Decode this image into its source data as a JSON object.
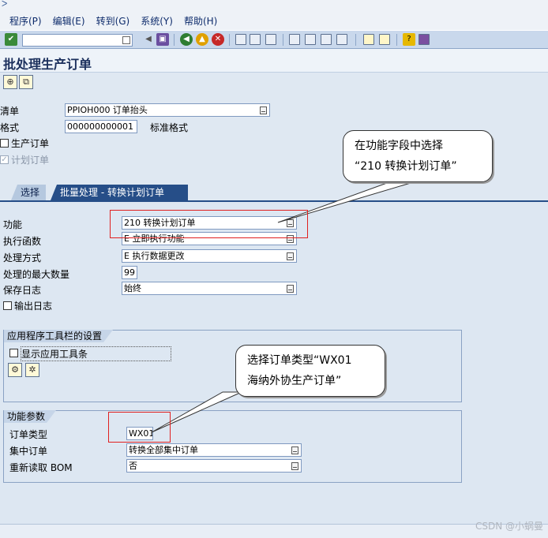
{
  "menu": [
    "程序(P)",
    "编辑(E)",
    "转到(G)",
    "系统(Y)",
    "帮助(H)"
  ],
  "page_title": "批处理生产订单",
  "header": {
    "list_label": "清单",
    "list_value": "PPIOH000 订单抬头",
    "format_label": "格式",
    "format_value": "000000000001",
    "format_desc": "标准格式",
    "cb_production": "生产订单",
    "cb_planned": "计划订单"
  },
  "tabs": [
    "选择",
    "批量处理 - 转换计划订单"
  ],
  "fields": {
    "function_label": "功能",
    "function_value": "210 转换计划订单",
    "exec_label": "执行函数",
    "exec_value": "E 立即执行功能",
    "method_label": "处理方式",
    "method_value": "E 执行数据更改",
    "max_label": "处理的最大数量",
    "max_value": "99",
    "log_label": "保存日志",
    "log_value": "始终",
    "output_log": "输出日志"
  },
  "group_toolbar": {
    "title": "应用程序工具栏的设置",
    "cb_label": "显示应用工具条"
  },
  "group_params": {
    "title": "功能参数",
    "order_type_label": "订单类型",
    "order_type_value": "WX01",
    "collective_label": "集中订单",
    "collective_value": "转换全部集中订单",
    "reread_label": "重新读取 BOM",
    "reread_value": "否"
  },
  "callouts": {
    "c1_line1": "在功能字段中选择",
    "c1_line2": "“210 转换计划订单”",
    "c2_line1": "选择订单类型“WX01",
    "c2_line2": "海纳外协生产订单”"
  },
  "watermark": "CSDN @小蜗曼",
  "colors": {
    "tab_active": "#264e88",
    "callout_border": "#e02020"
  }
}
